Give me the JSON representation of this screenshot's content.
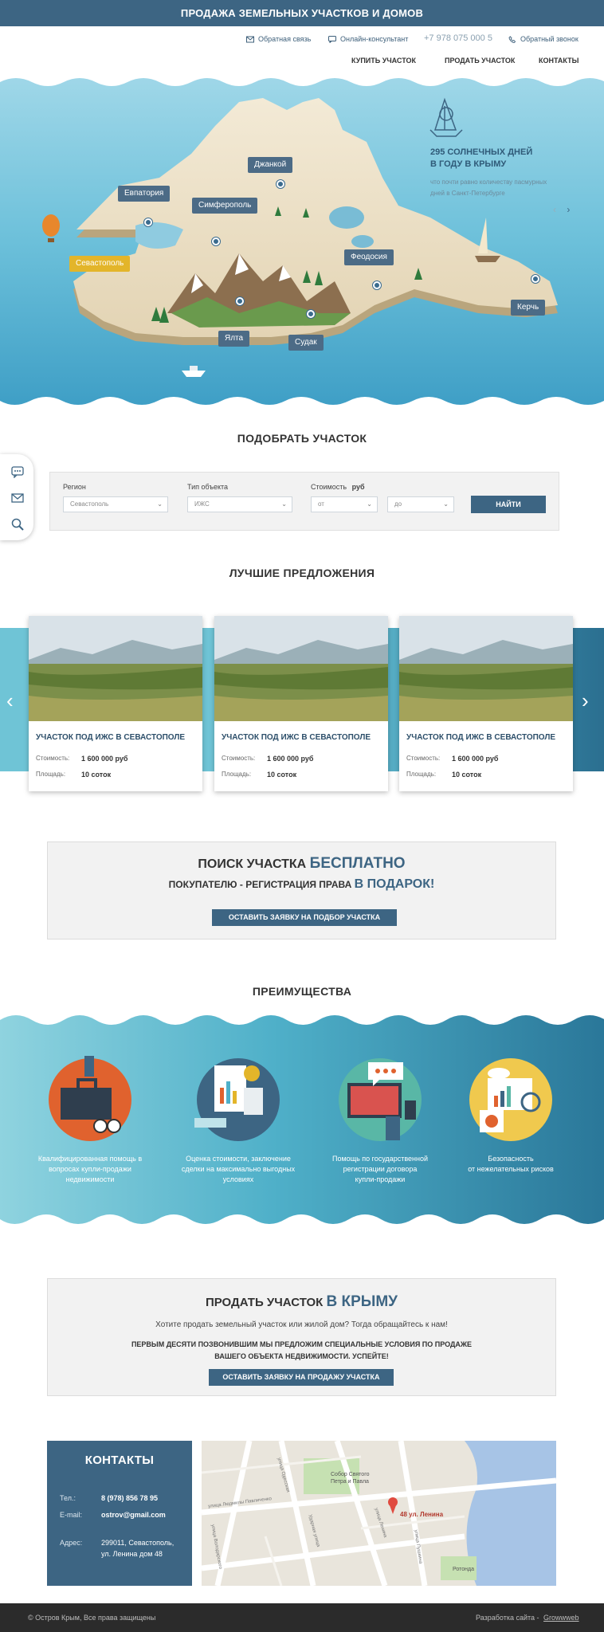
{
  "topbar": {
    "title": "ПРОДАЖА ЗЕМЕЛЬНЫХ УЧАСТКОВ И ДОМОВ"
  },
  "contacts": {
    "feedback": "Обратная связь",
    "consultant": "Онлайн-консультант",
    "phone": "+7 978 075 000 5",
    "callback": "Обратный звонок"
  },
  "nav": {
    "buy": "КУПИТЬ УЧАСТОК",
    "sell": "ПРОДАТЬ УЧАСТОК",
    "contacts": "КОНТАКТЫ"
  },
  "hero": {
    "cities": [
      "Евпатория",
      "Симферополь",
      "Джанкой",
      "Севастополь",
      "Феодосия",
      "Ялта",
      "Судак",
      "Керчь"
    ],
    "headline": "295 СОЛНЕЧНЫХ ДНЕЙ В ГОДУ В КРЫМУ",
    "headline_line1": "295 СОЛНЕЧНЫХ ДНЕЙ",
    "headline_line2": "В ГОДУ В КРЫМУ",
    "description_line1": "что почти равно количеству пасмурных",
    "description_line2": "дней в Санкт-Петербурге",
    "prev": "‹",
    "next": "›"
  },
  "filter": {
    "heading": "ПОДОБРАТЬ УЧАСТОК",
    "region_label": "Регион",
    "region_value": "Севастополь",
    "type_label": "Тип объекта",
    "type_value": "ИЖС",
    "price_label": "Стоимость",
    "price_unit": "руб",
    "from": "от",
    "to": "до",
    "submit": "НАЙТИ"
  },
  "offers": {
    "heading": "ЛУЧШИЕ ПРЕДЛОЖЕНИЯ",
    "price_label": "Стоимость:",
    "area_label": "Площадь:",
    "cards": [
      {
        "title": "УЧАСТОК ПОД ИЖС В СЕВАСТОПОЛЕ",
        "price": "1 600 000 руб",
        "area": "10 соток"
      },
      {
        "title": "УЧАСТОК ПОД ИЖС В СЕВАСТОПОЛЕ",
        "price": "1 600 000 руб",
        "area": "10 соток"
      },
      {
        "title": "УЧАСТОК ПОД ИЖС В СЕВАСТОПОЛЕ",
        "price": "1 600 000 руб",
        "area": "10 соток"
      }
    ],
    "prev": "‹",
    "next": "›"
  },
  "promo_search": {
    "line1_a": "ПОИСК УЧАСТКА",
    "line1_b": "БЕСПЛАТНО",
    "line2_a": "ПОКУПАТЕЛЮ - РЕГИСТРАЦИЯ ПРАВА",
    "line2_b": "В ПОДАРОК!",
    "button": "ОСТАВИТЬ ЗАЯВКУ НА ПОДБОР УЧАСТКА"
  },
  "advantages": {
    "heading": "ПРЕИМУЩЕСТВА",
    "items": [
      {
        "line1": "Квалифицированная помощь в",
        "line2": "вопросах купли-продажи",
        "line3": "недвижимости"
      },
      {
        "line1": "Оценка стоимости, заключение",
        "line2": "сделки на максимально выгодных",
        "line3": "условиях"
      },
      {
        "line1": "Помощь по государственной",
        "line2": "регистрации договора",
        "line3": "купли-продажи"
      },
      {
        "line1": "Безопасность",
        "line2": "от нежелательных рисков",
        "line3": ""
      }
    ]
  },
  "promo_sell": {
    "title_a": "ПРОДАТЬ УЧАСТОК",
    "title_b": "В КРЫМУ",
    "text": "Хотите продать земельный участок или жилой дом? Тогда обращайтесь к нам!",
    "offer_line1": "ПЕРВЫМ ДЕСЯТИ ПОЗВОНИВШИМ МЫ ПРЕДЛОЖИМ СПЕЦИАЛЬНЫЕ УСЛОВИЯ ПО ПРОДАЖЕ",
    "offer_line2": "ВАШЕГО ОБЪЕКТА НЕДВИЖИМОСТИ. УСПЕЙТЕ!",
    "button": "ОСТАВИТЬ ЗАЯВКУ НА ПРОДАЖУ УЧАСТКА"
  },
  "contact_box": {
    "title": "КОНТАКТЫ",
    "phone_label": "Тел.:",
    "phone": "8 (978) 856 78 95",
    "email_label": "E-mail:",
    "email": "ostrov@gmail.com",
    "address_label": "Адрес:",
    "address_line1": "299011, Севастополь,",
    "address_line2": "ул. Ленина дом 48"
  },
  "map": {
    "marker_label": "48 ул. Ленина",
    "church": "Собор Святого Петра и Павла",
    "church_line1": "Собор Святого",
    "church_line2": "Петра и Павла",
    "rotunda": "Ротонда",
    "streets": [
      "улица Людмилы Павличенко",
      "улица Одесская",
      "Ударная улица",
      "улица Володарского",
      "улица Ленина",
      "улица Пушкина"
    ]
  },
  "footer": {
    "copyright": "© Остров Крым, Все права защищены",
    "dev_prefix": "Разработка сайта -",
    "dev_link": "Growwweb"
  },
  "colors": {
    "primary": "#3d6583",
    "sea": "#5fb7d3",
    "accent_yellow": "#e3b52a",
    "footer": "#2b2b2b"
  }
}
